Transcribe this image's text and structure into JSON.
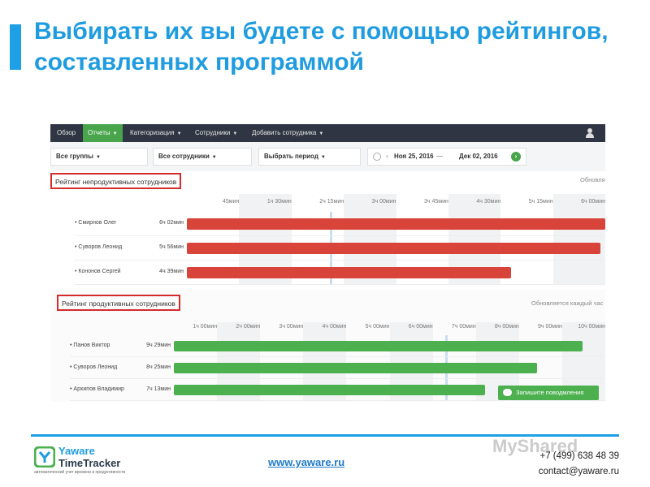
{
  "slide": {
    "title_line1": "Выбирать их вы будете с помощью рейтингов,",
    "title_line2": "составленных программой",
    "accent_color": "#1ea0e6"
  },
  "app": {
    "nav": {
      "items": [
        "Обзор",
        "Отчеты",
        "Категоризация",
        "Сотрудники",
        "Добавить сотрудника"
      ],
      "active_index": 1,
      "user_icon": "user-icon"
    },
    "filters": {
      "groups": "Все группы",
      "employees": "Все сотрудники",
      "period": "Выбрать период",
      "date_from": "Ноя 25, 2016",
      "date_to": "Дек 02, 2016",
      "prev_icon": "chevron-left-icon",
      "next_icon": "chevron-right-icon"
    },
    "unproductive": {
      "title": "Рейтинг непродуктивных сотрудников",
      "update_note": "Обновля",
      "ticks": [
        "45мин",
        "1ч 30мин",
        "2ч 15мин",
        "3ч 00мин",
        "3ч 45мин",
        "4ч 30мин",
        "5ч 15мин",
        "6ч 00мин"
      ],
      "rows": [
        {
          "name": "• Смирнов Олег",
          "duration": "6ч 02мин",
          "hours": 6.03
        },
        {
          "name": "• Суворов Леонид",
          "duration": "5ч 56мин",
          "hours": 5.93
        },
        {
          "name": "• Кононов Сергей",
          "duration": "4ч 39мин",
          "hours": 4.65
        }
      ],
      "bar_color": "#d9443a"
    },
    "productive": {
      "title": "Рейтинг продуктивных сотрудников",
      "update_note": "Обновляется каждый час",
      "ticks": [
        "1ч 00мин",
        "2ч 00мин",
        "3ч 00мин",
        "4ч 00мин",
        "5ч 00мин",
        "6ч 00мин",
        "7ч 00мин",
        "8ч 00мин",
        "9ч 00мин",
        "10ч 00мин"
      ],
      "rows": [
        {
          "name": "• Панов Виктор",
          "duration": "9ч 29мин",
          "hours": 9.48
        },
        {
          "name": "• Суворов Леонид",
          "duration": "8ч 25мин",
          "hours": 8.42
        },
        {
          "name": "• Архипов Владимир",
          "duration": "7ч 13мин",
          "hours": 7.22
        }
      ],
      "bar_color": "#4cb04f"
    },
    "chat_button": "Запишите поводмления"
  },
  "footer": {
    "logo_line1": "Yaware",
    "logo_line2": "TimeTracker",
    "logo_tagline": "автоматический учет времени и продуктивности",
    "website": "www.yaware.ru",
    "phone": "+7 (499) 638 48 39",
    "email": "contact@yaware.ru",
    "watermark": "MyShared"
  }
}
